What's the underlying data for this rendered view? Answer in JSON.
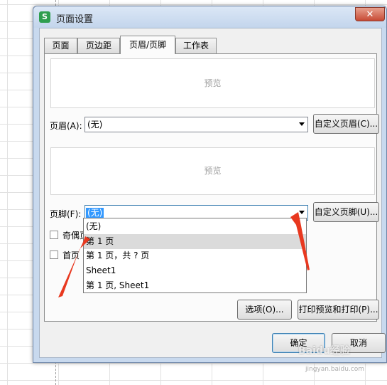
{
  "window": {
    "title": "页面设置",
    "app_icon_letter": "S",
    "close_glyph": "✕"
  },
  "tabs": [
    {
      "label": "页面",
      "active": false
    },
    {
      "label": "页边距",
      "active": false
    },
    {
      "label": "页眉/页脚",
      "active": true
    },
    {
      "label": "工作表",
      "active": false
    }
  ],
  "header_section": {
    "preview_text": "预览",
    "label": "页眉(A):",
    "value": "(无)",
    "custom_button": "自定义页眉(C)..."
  },
  "footer_section": {
    "preview_text": "预览",
    "label": "页脚(F):",
    "value": "(无)",
    "custom_button": "自定义页脚(U)..."
  },
  "footer_dropdown": {
    "options": [
      "(无)",
      "第 1 页",
      "第 1 页，共 ? 页",
      "Sheet1",
      "第 1 页, Sheet1"
    ],
    "hovered_index": 1
  },
  "checkboxes": [
    {
      "label": "奇偶页",
      "checked": false
    },
    {
      "label": "首页",
      "checked": false
    }
  ],
  "buttons": {
    "options": "选项(O)...",
    "print_preview": "打印预览和打印(P)...",
    "ok": "确定",
    "cancel": "取消"
  },
  "watermark": {
    "text": "Baidu经验",
    "sub": "jingyan.baidu.com"
  },
  "colors": {
    "annotation_arrow": "#e8381f",
    "hover_row": "#dbdbdb",
    "selection": "#3399ff"
  }
}
